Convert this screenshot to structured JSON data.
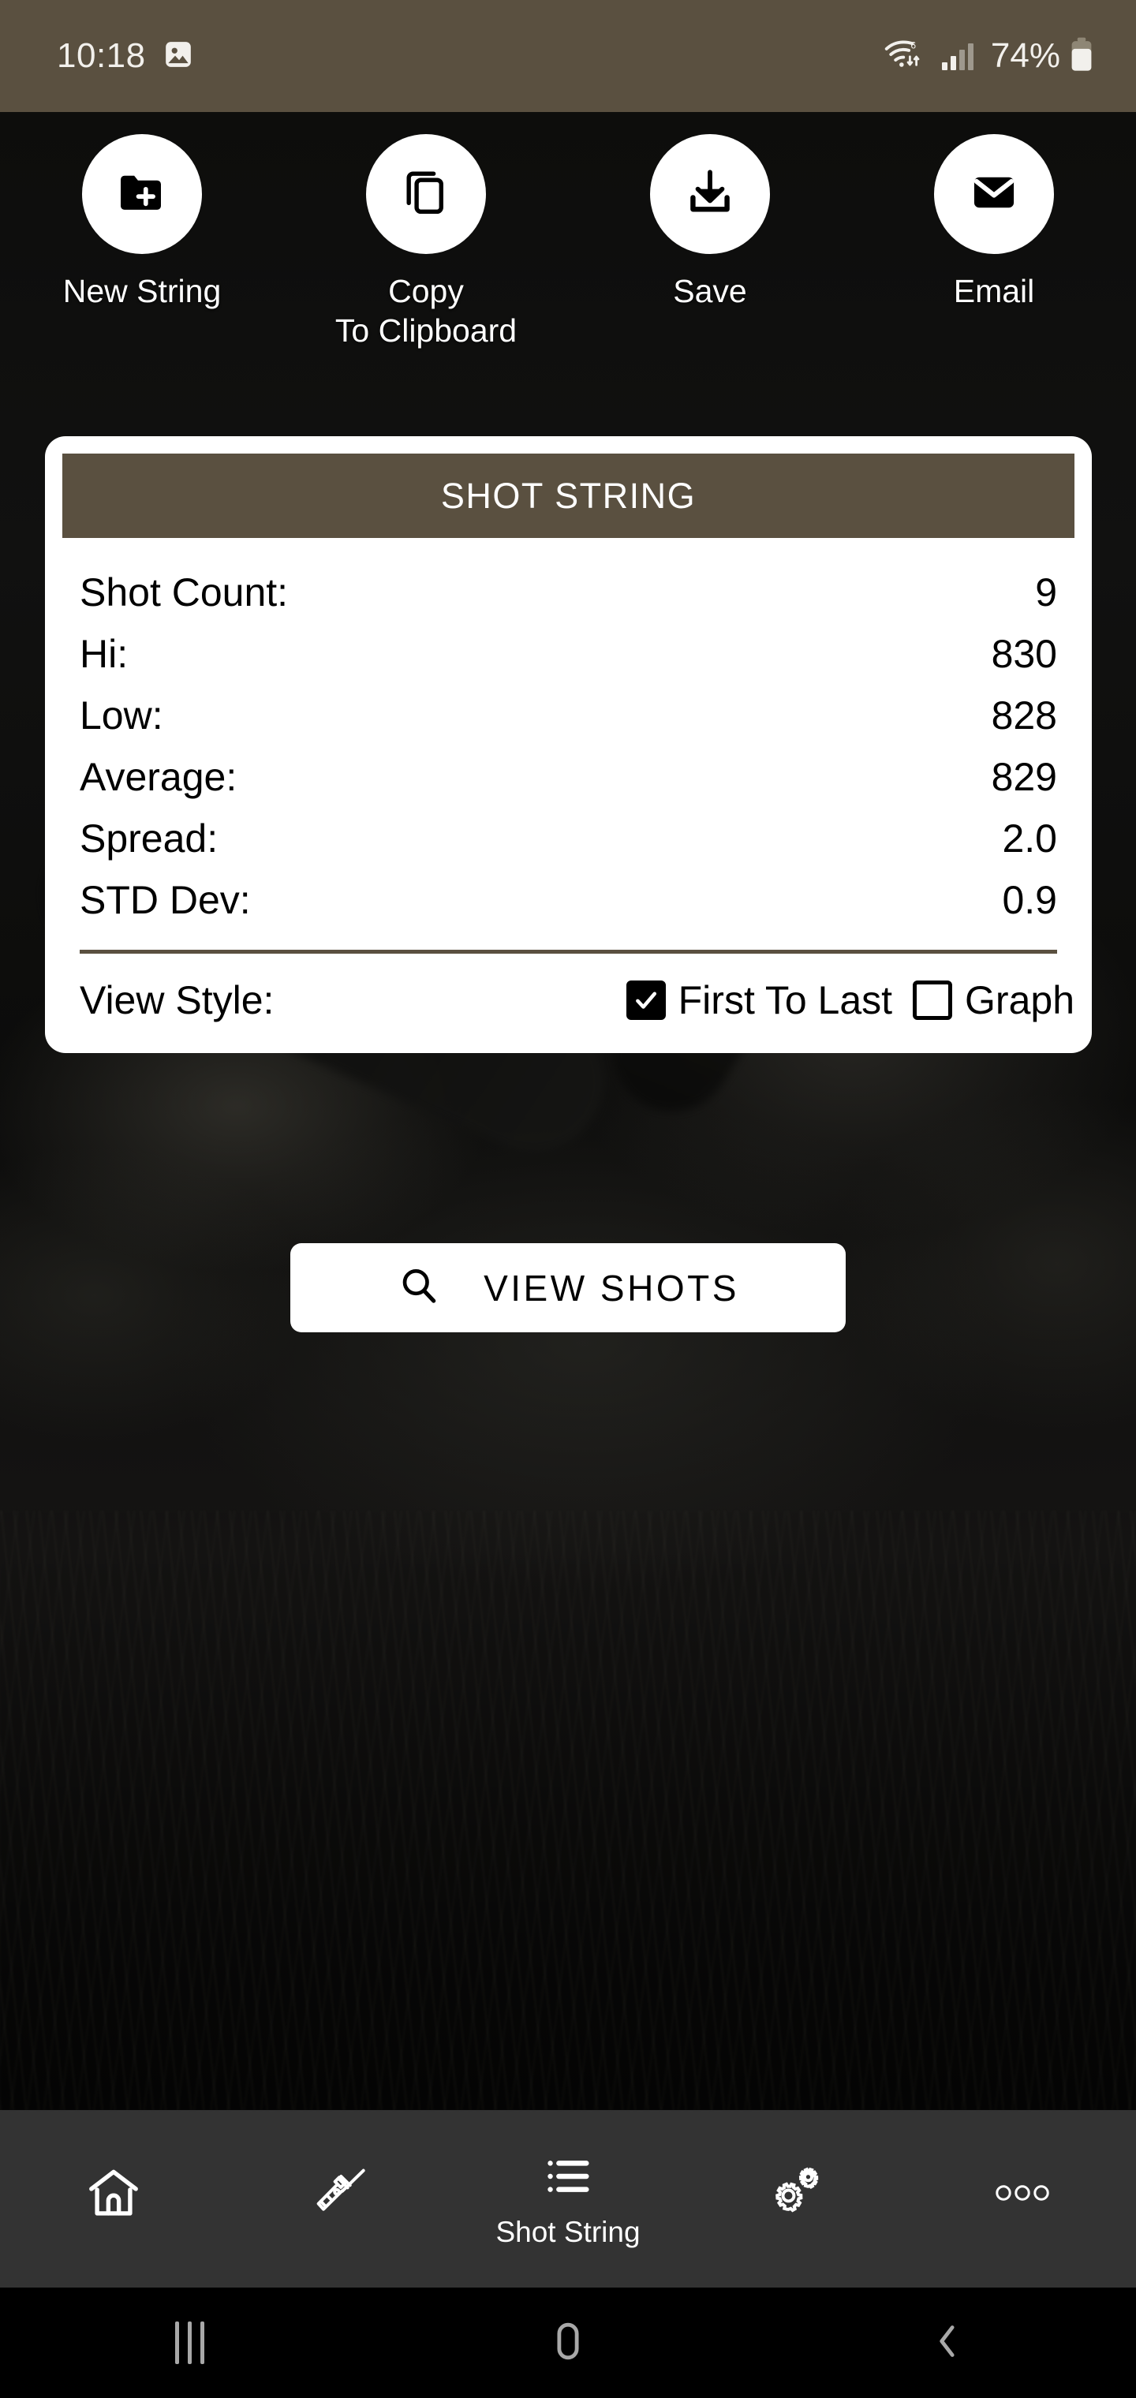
{
  "status_bar": {
    "time": "10:18",
    "battery_text": "74%",
    "icons": [
      "image-icon",
      "wifi-icon",
      "signal-icon",
      "battery-icon"
    ],
    "background_color": "#5A5040"
  },
  "quick_actions": [
    {
      "label": "New String",
      "icon": "folder-add-icon"
    },
    {
      "label": "Copy\nTo Clipboard",
      "icon": "copy-icon"
    },
    {
      "label": "Save",
      "icon": "download-icon"
    },
    {
      "label": "Email",
      "icon": "envelope-icon"
    }
  ],
  "shot_card": {
    "header_title": "SHOT STRING",
    "header_color": "#5A5040",
    "stats": [
      {
        "label": "Shot Count:",
        "value": "9"
      },
      {
        "label": "Hi:",
        "value": "830"
      },
      {
        "label": "Low:",
        "value": "828"
      },
      {
        "label": "Average:",
        "value": "829"
      },
      {
        "label": "Spread:",
        "value": "2.0"
      },
      {
        "label": "STD Dev:",
        "value": "0.9"
      }
    ],
    "view_style": {
      "label": "View Style:",
      "options": [
        {
          "label": "First To Last",
          "checked": true
        },
        {
          "label": "Graph",
          "checked": false
        }
      ]
    }
  },
  "view_shots_button": {
    "label": "VIEW SHOTS",
    "icon": "search-icon"
  },
  "app_nav": {
    "items": [
      {
        "label": "",
        "icon": "home-icon",
        "active": false
      },
      {
        "label": "",
        "icon": "rifle-icon",
        "active": false
      },
      {
        "label": "Shot String",
        "icon": "list-icon",
        "active": true
      },
      {
        "label": "",
        "icon": "gears-icon",
        "active": false
      },
      {
        "label": "",
        "icon": "more-dots-icon",
        "active": false
      }
    ]
  },
  "system_nav": {
    "buttons": [
      {
        "name": "recents",
        "icon": "recents-icon"
      },
      {
        "name": "home",
        "icon": "home-circle-icon"
      },
      {
        "name": "back",
        "icon": "back-chevron-icon"
      }
    ]
  }
}
